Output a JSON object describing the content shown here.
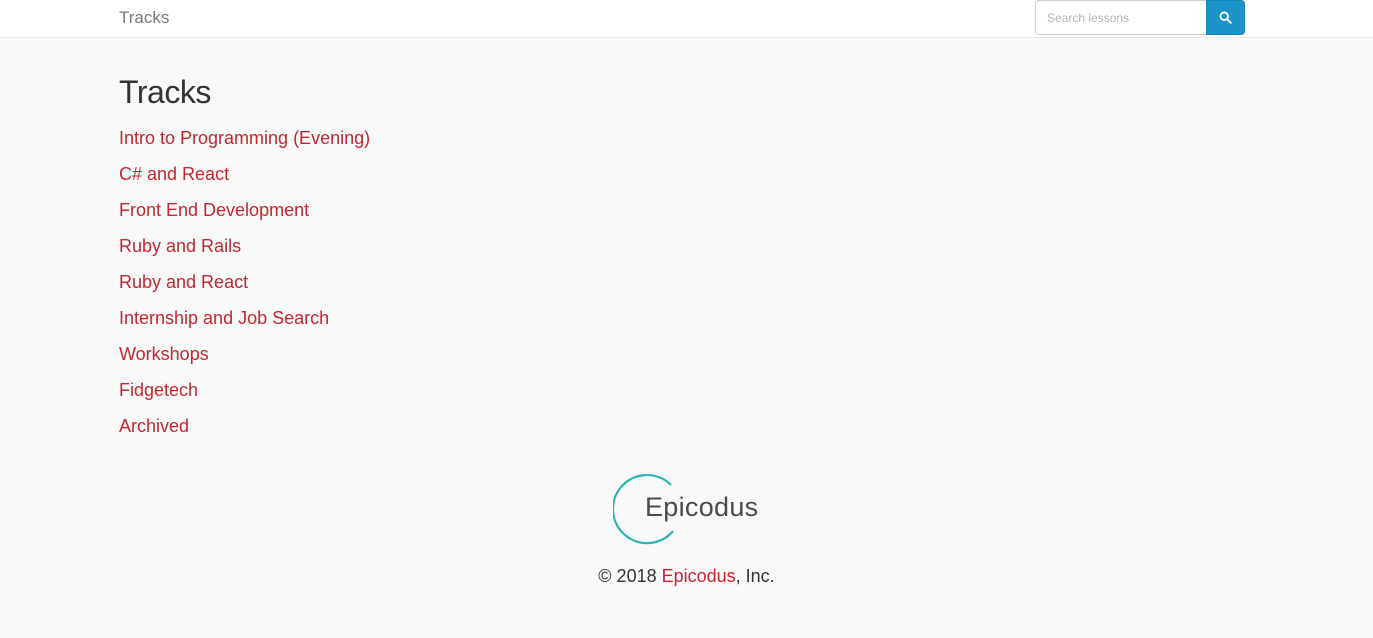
{
  "header": {
    "brand": "Tracks",
    "search": {
      "placeholder": "Search lessons",
      "value": "",
      "button_icon": "search-icon"
    }
  },
  "main": {
    "title": "Tracks",
    "tracks": [
      {
        "label": "Intro to Programming (Evening)"
      },
      {
        "label": "C# and React"
      },
      {
        "label": "Front End Development"
      },
      {
        "label": "Ruby and Rails"
      },
      {
        "label": "Ruby and React"
      },
      {
        "label": "Internship and Job Search"
      },
      {
        "label": "Workshops"
      },
      {
        "label": "Fidgetech"
      },
      {
        "label": "Archived"
      }
    ]
  },
  "footer": {
    "logo_text": "Epicodus",
    "copyright_prefix": "© 2018 ",
    "copyright_link": "Epicodus",
    "copyright_suffix": ", Inc."
  },
  "colors": {
    "link": "#c4262e",
    "search_button": "#1a94c8",
    "logo_ring": "#2bb5b4",
    "background": "#f9f9f9"
  }
}
